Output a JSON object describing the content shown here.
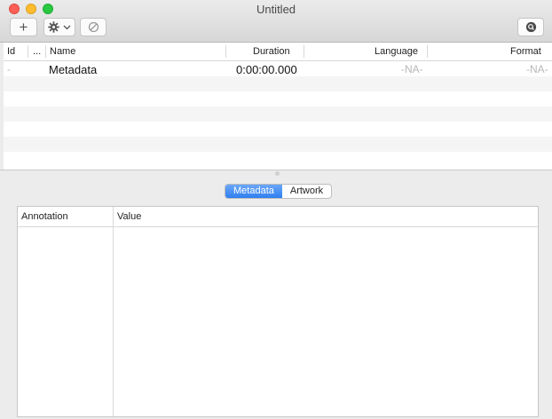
{
  "window": {
    "title": "Untitled"
  },
  "toolbar": {
    "add_label": "+"
  },
  "table": {
    "columns": {
      "id": "Id",
      "ellipsis": "...",
      "name": "Name",
      "duration": "Duration",
      "language": "Language",
      "format": "Format"
    },
    "rows": [
      {
        "id": "-",
        "name": "Metadata",
        "duration": "0:00:00.000",
        "language": "-NA-",
        "format": "-NA-"
      }
    ]
  },
  "tabs": [
    {
      "label": "Metadata",
      "active": true
    },
    {
      "label": "Artwork",
      "active": false
    }
  ],
  "metadata_panel": {
    "columns": {
      "annotation": "Annotation",
      "value": "Value"
    }
  },
  "colors": {
    "accent": "#2f7ef0",
    "close": "#fd5f57",
    "minimize": "#febc2e",
    "maximize": "#28c840"
  }
}
